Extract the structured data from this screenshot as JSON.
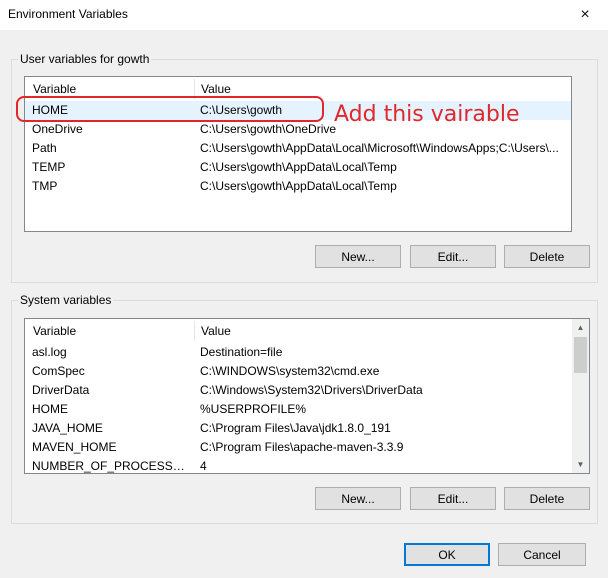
{
  "window": {
    "title": "Environment Variables",
    "close_icon": "×"
  },
  "user_vars": {
    "group_label": "User variables for gowth",
    "columns": {
      "variable": "Variable",
      "value": "Value"
    },
    "rows": [
      {
        "variable": "HOME",
        "value": "C:\\Users\\gowth"
      },
      {
        "variable": "OneDrive",
        "value": "C:\\Users\\gowth\\OneDrive"
      },
      {
        "variable": "Path",
        "value": "C:\\Users\\gowth\\AppData\\Local\\Microsoft\\WindowsApps;C:\\Users\\..."
      },
      {
        "variable": "TEMP",
        "value": "C:\\Users\\gowth\\AppData\\Local\\Temp"
      },
      {
        "variable": "TMP",
        "value": "C:\\Users\\gowth\\AppData\\Local\\Temp"
      }
    ],
    "buttons": {
      "new": "New...",
      "edit": "Edit...",
      "delete": "Delete"
    }
  },
  "system_vars": {
    "group_label": "System variables",
    "columns": {
      "variable": "Variable",
      "value": "Value"
    },
    "rows": [
      {
        "variable": "asl.log",
        "value": "Destination=file"
      },
      {
        "variable": "ComSpec",
        "value": "C:\\WINDOWS\\system32\\cmd.exe"
      },
      {
        "variable": "DriverData",
        "value": "C:\\Windows\\System32\\Drivers\\DriverData"
      },
      {
        "variable": "HOME",
        "value": "%USERPROFILE%"
      },
      {
        "variable": "JAVA_HOME",
        "value": "C:\\Program Files\\Java\\jdk1.8.0_191"
      },
      {
        "variable": "MAVEN_HOME",
        "value": "C:\\Program Files\\apache-maven-3.3.9"
      },
      {
        "variable": "NUMBER_OF_PROCESSORS",
        "value": "4"
      }
    ],
    "buttons": {
      "new": "New...",
      "edit": "Edit...",
      "delete": "Delete"
    }
  },
  "dialog_buttons": {
    "ok": "OK",
    "cancel": "Cancel"
  },
  "annotation": {
    "text": "Add this vairable",
    "color": "#e0272b"
  },
  "colors": {
    "selection": "#e5f3ff",
    "default_button_border": "#0078d7"
  }
}
